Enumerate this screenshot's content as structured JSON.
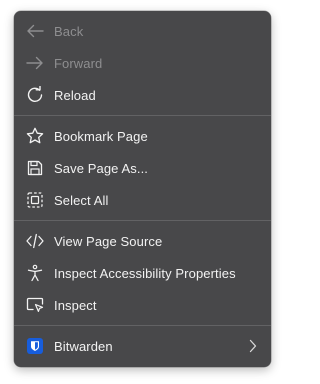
{
  "menu": {
    "groups": [
      {
        "items": [
          {
            "label": "Back",
            "icon": "arrow-left-icon",
            "disabled": true
          },
          {
            "label": "Forward",
            "icon": "arrow-right-icon",
            "disabled": true
          },
          {
            "label": "Reload",
            "icon": "reload-icon",
            "disabled": false
          }
        ]
      },
      {
        "items": [
          {
            "label": "Bookmark Page",
            "icon": "star-icon",
            "disabled": false
          },
          {
            "label": "Save Page As...",
            "icon": "save-icon",
            "disabled": false
          },
          {
            "label": "Select All",
            "icon": "select-all-icon",
            "disabled": false
          }
        ]
      },
      {
        "items": [
          {
            "label": "View Page Source",
            "icon": "code-icon",
            "disabled": false
          },
          {
            "label": "Inspect Accessibility Properties",
            "icon": "accessibility-icon",
            "disabled": false
          },
          {
            "label": "Inspect",
            "icon": "inspect-icon",
            "disabled": false
          }
        ]
      },
      {
        "items": [
          {
            "label": "Bitwarden",
            "icon": "bitwarden-icon",
            "disabled": false,
            "submenu": true
          }
        ]
      }
    ]
  },
  "colors": {
    "menu_bg": "#48484a",
    "text": "#f2f2f2",
    "disabled_text": "#8e8e90",
    "separator": "#626264",
    "bitwarden_blue": "#175ddc"
  }
}
